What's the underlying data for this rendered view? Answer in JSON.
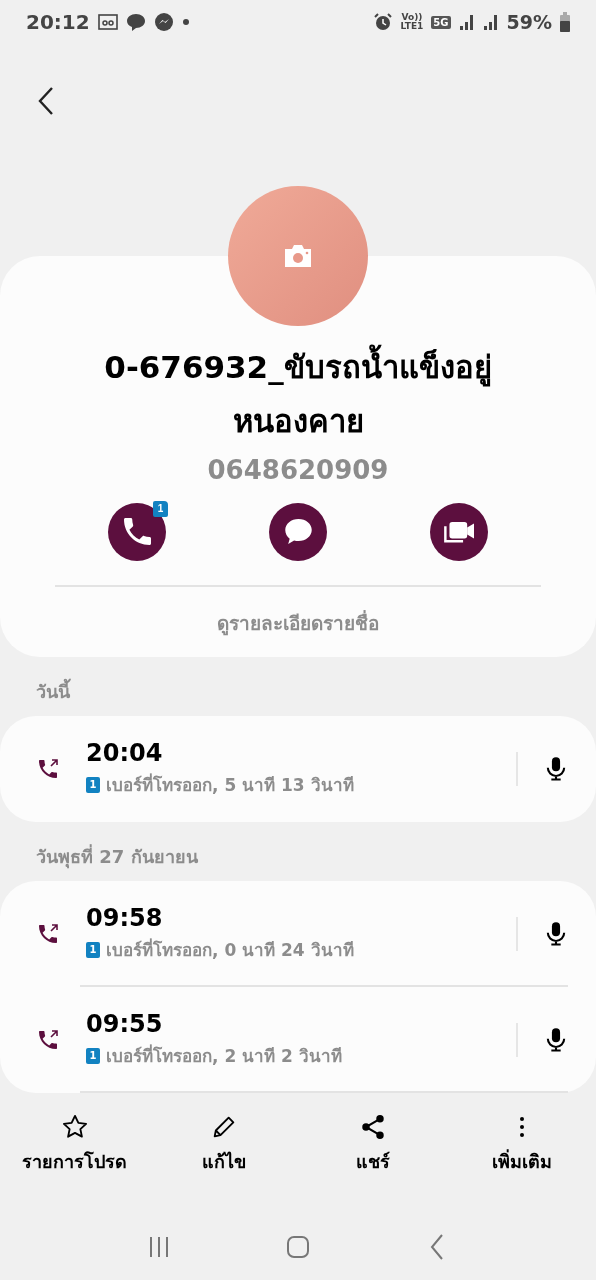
{
  "status_bar": {
    "time": "20:12",
    "volte": "Vo))",
    "lte": "LTE1",
    "network": "5G",
    "battery": "59%"
  },
  "contact": {
    "name": "0-676932_ขับรถน้ำแข็งอยู่หนองคาย",
    "number": "0648620909",
    "call_badge": "1",
    "details_link": "ดูรายละเอียดรายชื่อ"
  },
  "sections": [
    {
      "title": "วันนี้",
      "calls": [
        {
          "time": "20:04",
          "sim": "1",
          "description": "เบอร์ที่โทรออก, 5 นาที 13 วินาที"
        }
      ]
    },
    {
      "title": "วันพุธที่ 27 กันยายน",
      "calls": [
        {
          "time": "09:58",
          "sim": "1",
          "description": "เบอร์ที่โทรออก, 0 นาที 24 วินาที"
        },
        {
          "time": "09:55",
          "sim": "1",
          "description": "เบอร์ที่โทรออก, 2 นาที 2 วินาที"
        }
      ]
    }
  ],
  "bottom_actions": [
    {
      "kind": "star",
      "label": "รายการโปรด"
    },
    {
      "kind": "edit",
      "label": "แก้ไข"
    },
    {
      "kind": "share",
      "label": "แชร์"
    },
    {
      "kind": "more",
      "label": "เพิ่มเติม"
    }
  ]
}
